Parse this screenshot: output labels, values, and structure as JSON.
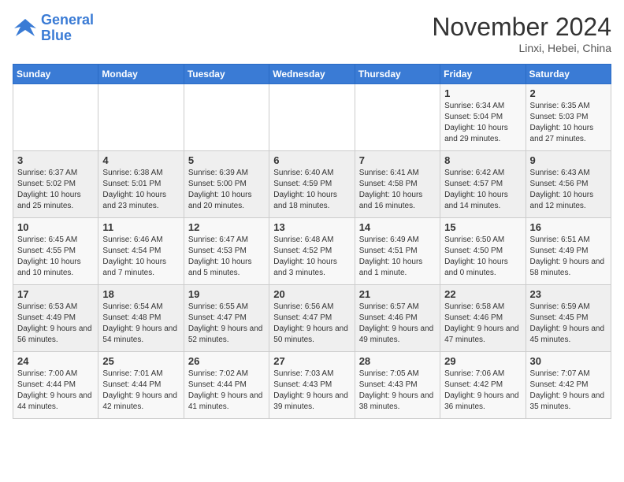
{
  "logo": {
    "line1": "General",
    "line2": "Blue"
  },
  "title": "November 2024",
  "subtitle": "Linxi, Hebei, China",
  "days_of_week": [
    "Sunday",
    "Monday",
    "Tuesday",
    "Wednesday",
    "Thursday",
    "Friday",
    "Saturday"
  ],
  "weeks": [
    [
      {
        "day": "",
        "info": ""
      },
      {
        "day": "",
        "info": ""
      },
      {
        "day": "",
        "info": ""
      },
      {
        "day": "",
        "info": ""
      },
      {
        "day": "",
        "info": ""
      },
      {
        "day": "1",
        "info": "Sunrise: 6:34 AM\nSunset: 5:04 PM\nDaylight: 10 hours and 29 minutes."
      },
      {
        "day": "2",
        "info": "Sunrise: 6:35 AM\nSunset: 5:03 PM\nDaylight: 10 hours and 27 minutes."
      }
    ],
    [
      {
        "day": "3",
        "info": "Sunrise: 6:37 AM\nSunset: 5:02 PM\nDaylight: 10 hours and 25 minutes."
      },
      {
        "day": "4",
        "info": "Sunrise: 6:38 AM\nSunset: 5:01 PM\nDaylight: 10 hours and 23 minutes."
      },
      {
        "day": "5",
        "info": "Sunrise: 6:39 AM\nSunset: 5:00 PM\nDaylight: 10 hours and 20 minutes."
      },
      {
        "day": "6",
        "info": "Sunrise: 6:40 AM\nSunset: 4:59 PM\nDaylight: 10 hours and 18 minutes."
      },
      {
        "day": "7",
        "info": "Sunrise: 6:41 AM\nSunset: 4:58 PM\nDaylight: 10 hours and 16 minutes."
      },
      {
        "day": "8",
        "info": "Sunrise: 6:42 AM\nSunset: 4:57 PM\nDaylight: 10 hours and 14 minutes."
      },
      {
        "day": "9",
        "info": "Sunrise: 6:43 AM\nSunset: 4:56 PM\nDaylight: 10 hours and 12 minutes."
      }
    ],
    [
      {
        "day": "10",
        "info": "Sunrise: 6:45 AM\nSunset: 4:55 PM\nDaylight: 10 hours and 10 minutes."
      },
      {
        "day": "11",
        "info": "Sunrise: 6:46 AM\nSunset: 4:54 PM\nDaylight: 10 hours and 7 minutes."
      },
      {
        "day": "12",
        "info": "Sunrise: 6:47 AM\nSunset: 4:53 PM\nDaylight: 10 hours and 5 minutes."
      },
      {
        "day": "13",
        "info": "Sunrise: 6:48 AM\nSunset: 4:52 PM\nDaylight: 10 hours and 3 minutes."
      },
      {
        "day": "14",
        "info": "Sunrise: 6:49 AM\nSunset: 4:51 PM\nDaylight: 10 hours and 1 minute."
      },
      {
        "day": "15",
        "info": "Sunrise: 6:50 AM\nSunset: 4:50 PM\nDaylight: 10 hours and 0 minutes."
      },
      {
        "day": "16",
        "info": "Sunrise: 6:51 AM\nSunset: 4:49 PM\nDaylight: 9 hours and 58 minutes."
      }
    ],
    [
      {
        "day": "17",
        "info": "Sunrise: 6:53 AM\nSunset: 4:49 PM\nDaylight: 9 hours and 56 minutes."
      },
      {
        "day": "18",
        "info": "Sunrise: 6:54 AM\nSunset: 4:48 PM\nDaylight: 9 hours and 54 minutes."
      },
      {
        "day": "19",
        "info": "Sunrise: 6:55 AM\nSunset: 4:47 PM\nDaylight: 9 hours and 52 minutes."
      },
      {
        "day": "20",
        "info": "Sunrise: 6:56 AM\nSunset: 4:47 PM\nDaylight: 9 hours and 50 minutes."
      },
      {
        "day": "21",
        "info": "Sunrise: 6:57 AM\nSunset: 4:46 PM\nDaylight: 9 hours and 49 minutes."
      },
      {
        "day": "22",
        "info": "Sunrise: 6:58 AM\nSunset: 4:46 PM\nDaylight: 9 hours and 47 minutes."
      },
      {
        "day": "23",
        "info": "Sunrise: 6:59 AM\nSunset: 4:45 PM\nDaylight: 9 hours and 45 minutes."
      }
    ],
    [
      {
        "day": "24",
        "info": "Sunrise: 7:00 AM\nSunset: 4:44 PM\nDaylight: 9 hours and 44 minutes."
      },
      {
        "day": "25",
        "info": "Sunrise: 7:01 AM\nSunset: 4:44 PM\nDaylight: 9 hours and 42 minutes."
      },
      {
        "day": "26",
        "info": "Sunrise: 7:02 AM\nSunset: 4:44 PM\nDaylight: 9 hours and 41 minutes."
      },
      {
        "day": "27",
        "info": "Sunrise: 7:03 AM\nSunset: 4:43 PM\nDaylight: 9 hours and 39 minutes."
      },
      {
        "day": "28",
        "info": "Sunrise: 7:05 AM\nSunset: 4:43 PM\nDaylight: 9 hours and 38 minutes."
      },
      {
        "day": "29",
        "info": "Sunrise: 7:06 AM\nSunset: 4:42 PM\nDaylight: 9 hours and 36 minutes."
      },
      {
        "day": "30",
        "info": "Sunrise: 7:07 AM\nSunset: 4:42 PM\nDaylight: 9 hours and 35 minutes."
      }
    ]
  ]
}
